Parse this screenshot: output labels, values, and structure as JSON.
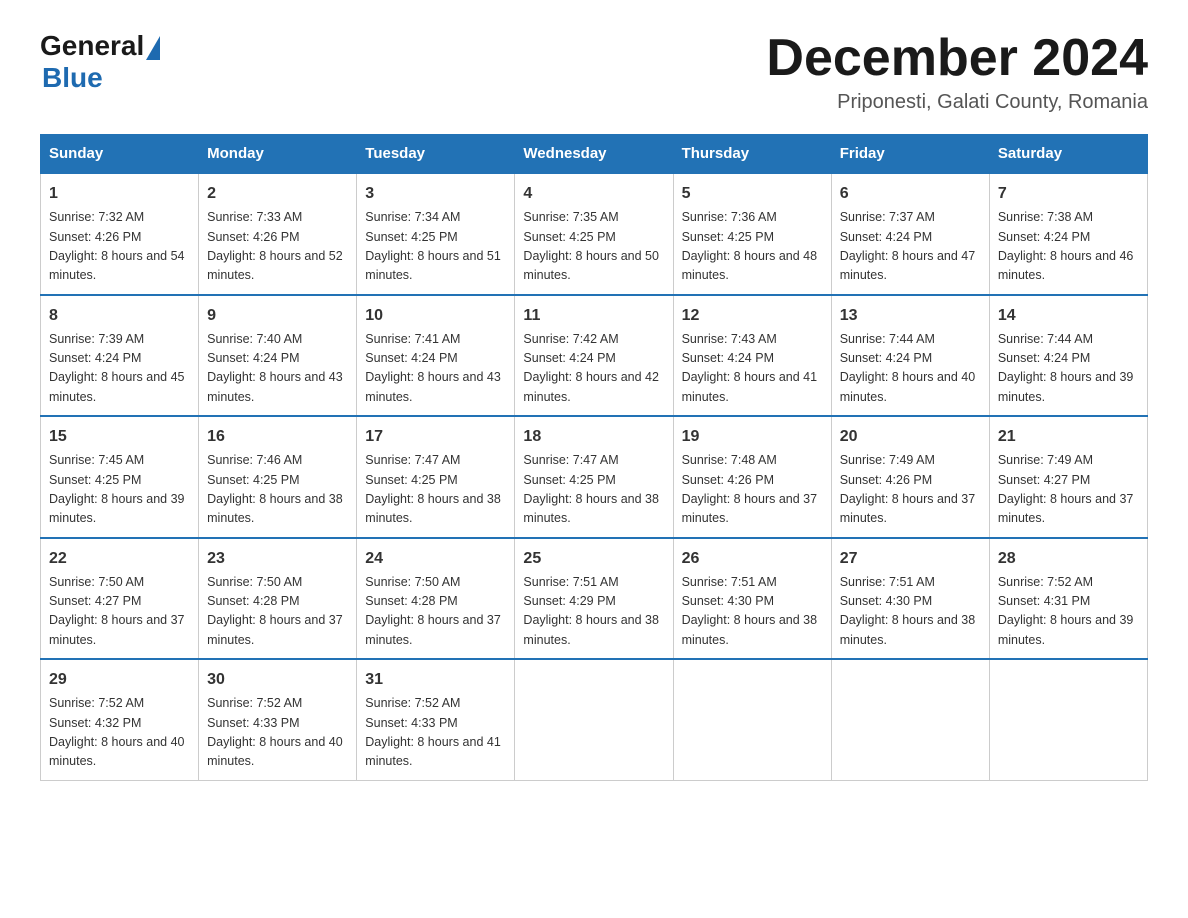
{
  "header": {
    "logo_general": "General",
    "logo_blue": "Blue",
    "title": "December 2024",
    "subtitle": "Priponesti, Galati County, Romania"
  },
  "days_of_week": [
    "Sunday",
    "Monday",
    "Tuesday",
    "Wednesday",
    "Thursday",
    "Friday",
    "Saturday"
  ],
  "weeks": [
    [
      {
        "day": "1",
        "sunrise": "7:32 AM",
        "sunset": "4:26 PM",
        "daylight": "8 hours and 54 minutes."
      },
      {
        "day": "2",
        "sunrise": "7:33 AM",
        "sunset": "4:26 PM",
        "daylight": "8 hours and 52 minutes."
      },
      {
        "day": "3",
        "sunrise": "7:34 AM",
        "sunset": "4:25 PM",
        "daylight": "8 hours and 51 minutes."
      },
      {
        "day": "4",
        "sunrise": "7:35 AM",
        "sunset": "4:25 PM",
        "daylight": "8 hours and 50 minutes."
      },
      {
        "day": "5",
        "sunrise": "7:36 AM",
        "sunset": "4:25 PM",
        "daylight": "8 hours and 48 minutes."
      },
      {
        "day": "6",
        "sunrise": "7:37 AM",
        "sunset": "4:24 PM",
        "daylight": "8 hours and 47 minutes."
      },
      {
        "day": "7",
        "sunrise": "7:38 AM",
        "sunset": "4:24 PM",
        "daylight": "8 hours and 46 minutes."
      }
    ],
    [
      {
        "day": "8",
        "sunrise": "7:39 AM",
        "sunset": "4:24 PM",
        "daylight": "8 hours and 45 minutes."
      },
      {
        "day": "9",
        "sunrise": "7:40 AM",
        "sunset": "4:24 PM",
        "daylight": "8 hours and 43 minutes."
      },
      {
        "day": "10",
        "sunrise": "7:41 AM",
        "sunset": "4:24 PM",
        "daylight": "8 hours and 43 minutes."
      },
      {
        "day": "11",
        "sunrise": "7:42 AM",
        "sunset": "4:24 PM",
        "daylight": "8 hours and 42 minutes."
      },
      {
        "day": "12",
        "sunrise": "7:43 AM",
        "sunset": "4:24 PM",
        "daylight": "8 hours and 41 minutes."
      },
      {
        "day": "13",
        "sunrise": "7:44 AM",
        "sunset": "4:24 PM",
        "daylight": "8 hours and 40 minutes."
      },
      {
        "day": "14",
        "sunrise": "7:44 AM",
        "sunset": "4:24 PM",
        "daylight": "8 hours and 39 minutes."
      }
    ],
    [
      {
        "day": "15",
        "sunrise": "7:45 AM",
        "sunset": "4:25 PM",
        "daylight": "8 hours and 39 minutes."
      },
      {
        "day": "16",
        "sunrise": "7:46 AM",
        "sunset": "4:25 PM",
        "daylight": "8 hours and 38 minutes."
      },
      {
        "day": "17",
        "sunrise": "7:47 AM",
        "sunset": "4:25 PM",
        "daylight": "8 hours and 38 minutes."
      },
      {
        "day": "18",
        "sunrise": "7:47 AM",
        "sunset": "4:25 PM",
        "daylight": "8 hours and 38 minutes."
      },
      {
        "day": "19",
        "sunrise": "7:48 AM",
        "sunset": "4:26 PM",
        "daylight": "8 hours and 37 minutes."
      },
      {
        "day": "20",
        "sunrise": "7:49 AM",
        "sunset": "4:26 PM",
        "daylight": "8 hours and 37 minutes."
      },
      {
        "day": "21",
        "sunrise": "7:49 AM",
        "sunset": "4:27 PM",
        "daylight": "8 hours and 37 minutes."
      }
    ],
    [
      {
        "day": "22",
        "sunrise": "7:50 AM",
        "sunset": "4:27 PM",
        "daylight": "8 hours and 37 minutes."
      },
      {
        "day": "23",
        "sunrise": "7:50 AM",
        "sunset": "4:28 PM",
        "daylight": "8 hours and 37 minutes."
      },
      {
        "day": "24",
        "sunrise": "7:50 AM",
        "sunset": "4:28 PM",
        "daylight": "8 hours and 37 minutes."
      },
      {
        "day": "25",
        "sunrise": "7:51 AM",
        "sunset": "4:29 PM",
        "daylight": "8 hours and 38 minutes."
      },
      {
        "day": "26",
        "sunrise": "7:51 AM",
        "sunset": "4:30 PM",
        "daylight": "8 hours and 38 minutes."
      },
      {
        "day": "27",
        "sunrise": "7:51 AM",
        "sunset": "4:30 PM",
        "daylight": "8 hours and 38 minutes."
      },
      {
        "day": "28",
        "sunrise": "7:52 AM",
        "sunset": "4:31 PM",
        "daylight": "8 hours and 39 minutes."
      }
    ],
    [
      {
        "day": "29",
        "sunrise": "7:52 AM",
        "sunset": "4:32 PM",
        "daylight": "8 hours and 40 minutes."
      },
      {
        "day": "30",
        "sunrise": "7:52 AM",
        "sunset": "4:33 PM",
        "daylight": "8 hours and 40 minutes."
      },
      {
        "day": "31",
        "sunrise": "7:52 AM",
        "sunset": "4:33 PM",
        "daylight": "8 hours and 41 minutes."
      },
      null,
      null,
      null,
      null
    ]
  ]
}
